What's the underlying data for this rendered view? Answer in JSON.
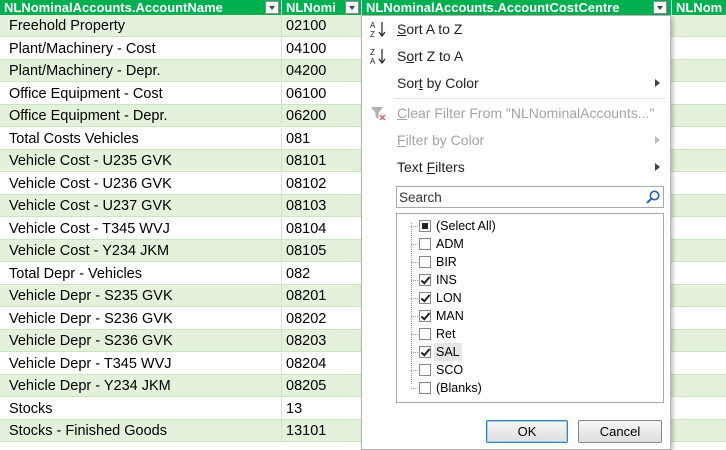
{
  "columns": [
    {
      "label": "NLNominalAccounts.AccountName"
    },
    {
      "label": "NLNomi"
    },
    {
      "label": "NLNominalAccounts.AccountCostCentre"
    },
    {
      "label": "NLNom"
    }
  ],
  "rows": [
    {
      "name": "Freehold Property",
      "code": "02100"
    },
    {
      "name": "Plant/Machinery - Cost",
      "code": "04100"
    },
    {
      "name": "Plant/Machinery - Depr.",
      "code": "04200"
    },
    {
      "name": "Office Equipment - Cost",
      "code": "06100"
    },
    {
      "name": "Office Equipment - Depr.",
      "code": "06200"
    },
    {
      "name": "Total Costs Vehicles",
      "code": "081"
    },
    {
      "name": "Vehicle Cost - U235 GVK",
      "code": "08101"
    },
    {
      "name": "Vehicle Cost - U236 GVK",
      "code": "08102"
    },
    {
      "name": "Vehicle Cost - U237 GVK",
      "code": "08103"
    },
    {
      "name": "Vehicle Cost - T345 WVJ",
      "code": "08104"
    },
    {
      "name": "Vehicle Cost - Y234 JKM",
      "code": "08105"
    },
    {
      "name": "Total Depr - Vehicles",
      "code": "082"
    },
    {
      "name": "Vehicle Depr - S235 GVK",
      "code": "08201"
    },
    {
      "name": "Vehicle Depr - S236 GVK",
      "code": "08202"
    },
    {
      "name": "Vehicle Depr - S236 GVK",
      "code": "08203"
    },
    {
      "name": "Vehicle Depr - T345 WVJ",
      "code": "08204"
    },
    {
      "name": "Vehicle Depr - Y234 JKM",
      "code": "08205"
    },
    {
      "name": "Stocks",
      "code": "13"
    },
    {
      "name": "Stocks - Finished Goods",
      "code": "13101"
    }
  ],
  "menu": {
    "sort_az_pre": "",
    "sort_az_key": "S",
    "sort_az_post": "ort A to Z",
    "sort_za_pre": "S",
    "sort_za_key": "o",
    "sort_za_post": "rt Z to A",
    "sort_color_pre": "Sor",
    "sort_color_key": "t",
    "sort_color_post": " by Color",
    "clear_pre": "",
    "clear_key": "C",
    "clear_post": "lear Filter From \"NLNominalAccounts...\"",
    "filter_color_pre": "",
    "filter_color_key": "F",
    "filter_color_post": "ilter by Color",
    "text_filters_pre": "Text ",
    "text_filters_key": "F",
    "text_filters_post": "ilters"
  },
  "search": {
    "placeholder": "Search"
  },
  "filter_items": [
    {
      "label": "(Select All)",
      "state": "partial"
    },
    {
      "label": "ADM",
      "state": "unchecked"
    },
    {
      "label": "BIR",
      "state": "unchecked"
    },
    {
      "label": "INS",
      "state": "checked"
    },
    {
      "label": "LON",
      "state": "checked"
    },
    {
      "label": "MAN",
      "state": "checked"
    },
    {
      "label": "Ret",
      "state": "unchecked"
    },
    {
      "label": "SAL",
      "state": "checked"
    },
    {
      "label": "SCO",
      "state": "unchecked"
    },
    {
      "label": "(Blanks)",
      "state": "unchecked"
    }
  ],
  "buttons": {
    "ok": "OK",
    "cancel": "Cancel"
  },
  "colors": {
    "header_green": "#00b050",
    "row_alt": "#e4f2dc"
  }
}
